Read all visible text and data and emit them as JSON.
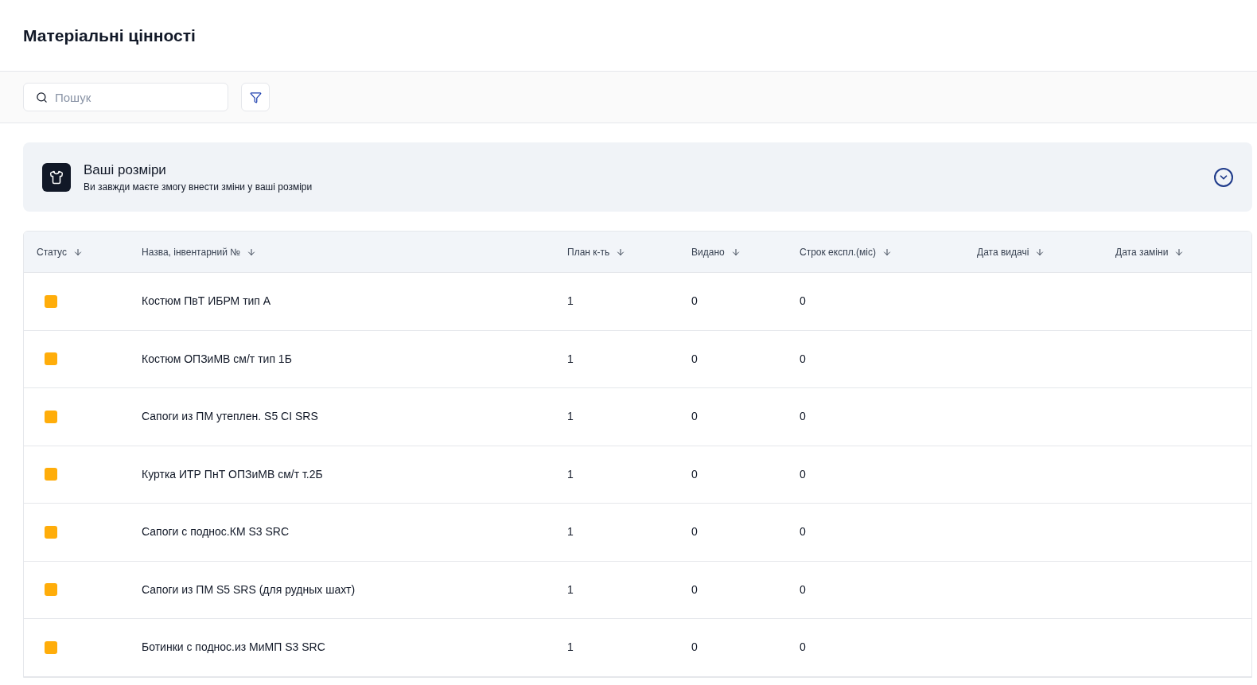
{
  "page_title": "Матеріальні цінності",
  "search": {
    "placeholder": "Пошук"
  },
  "sizes_card": {
    "title": "Ваші розміри",
    "subtitle": "Ви завжди маєте змогу внести зміни у ваші розміри",
    "expanded": false
  },
  "table": {
    "columns": [
      "Статус",
      "Назва, інвентарний №",
      "План к-ть",
      "Видано",
      "Строк експл.(міс)",
      "Дата видачі",
      "Дата заміни"
    ],
    "rows": [
      {
        "color": "#ffad0a",
        "name": "Костюм ПвТ ИБРМ тип А",
        "plan": "1",
        "issued": "0",
        "term": "0"
      },
      {
        "color": "#ffad0a",
        "name": "Костюм ОПЗиМВ см/т тип 1Б",
        "plan": "1",
        "issued": "0",
        "term": "0"
      },
      {
        "color": "#ffad0a",
        "name": "Сапоги из ПМ утеплен. S5 CI SRS",
        "plan": "1",
        "issued": "0",
        "term": "0"
      },
      {
        "color": "#ffad0a",
        "name": "Куртка ИТР ПнТ ОПЗиМВ см/т т.2Б",
        "plan": "1",
        "issued": "0",
        "term": "0"
      },
      {
        "color": "#ffad0a",
        "name": "Сапоги с поднос.КМ S3 SRC",
        "plan": "1",
        "issued": "0",
        "term": "0"
      },
      {
        "color": "#ffad0a",
        "name": "Сапоги из ПМ S5 SRS (для рудных шахт)",
        "plan": "1",
        "issued": "0",
        "term": "0"
      },
      {
        "color": "#ffad0a",
        "name": "Ботинки с поднос.из МиМП S3 SRC",
        "plan": "1",
        "issued": "0",
        "term": "0"
      }
    ]
  }
}
